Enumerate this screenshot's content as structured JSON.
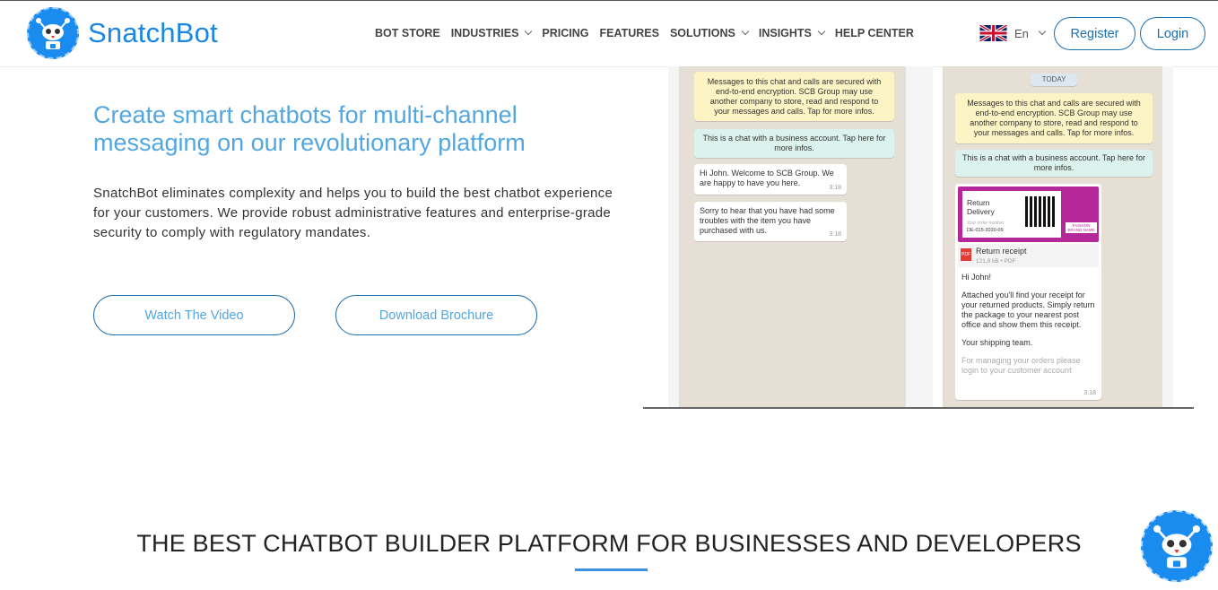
{
  "brand": {
    "name": "SnatchBot",
    "accent": "#1a86e6"
  },
  "nav": {
    "items": [
      {
        "label": "BOT STORE",
        "dropdown": false
      },
      {
        "label": "INDUSTRIES",
        "dropdown": true
      },
      {
        "label": "PRICING",
        "dropdown": false
      },
      {
        "label": "FEATURES",
        "dropdown": false
      },
      {
        "label": "SOLUTIONS",
        "dropdown": true
      },
      {
        "label": "INSIGHTS",
        "dropdown": true
      },
      {
        "label": "HELP CENTER",
        "dropdown": false
      }
    ],
    "language": "En",
    "register_label": "Register",
    "login_label": "Login"
  },
  "hero": {
    "title": "Create smart chatbots for multi-channel messaging on our revolutionary platform",
    "description": "SnatchBot eliminates complexity and helps you to build the best chatbot experience for your customers. We provide robust administrative features and enterprise-grade security to comply with regulatory mandates.",
    "watch_video_label": "Watch The Video",
    "download_brochure_label": "Download Brochure"
  },
  "chat_left": {
    "encryption_notice": "Messages to this chat and calls are secured with end-to-end encryption. SCB Group may use another company to store, read and respond to your messages and calls. Tap for more infos.",
    "business_notice": "This is a chat with a business account. Tap here for more infos.",
    "msg1": "Hi John. Welcome to SCB Group. We are happy to have you here.",
    "msg1_time": "3:18",
    "msg2": "Sorry to hear that you have had some troubles with the item you have purchased with us.",
    "msg2_time": "3:18"
  },
  "chat_right": {
    "date_chip": "TODAY",
    "encryption_notice": "Messages to this chat and calls are secured with end-to-end encryption. SCB Group may use another company to store, read and respond to your messages and calls. Tap for more infos.",
    "business_notice": "This is a chat with a business account. Tap here for more infos.",
    "card_title": "Return Delivery",
    "card_order_label": "Your order number",
    "card_order_number": "DE-015-2020-09",
    "card_brand": "FASHION BRAND NAME",
    "file_badge": "PDF",
    "file_name": "Return receipt",
    "file_meta": "121,9 kB • PDF",
    "greeting": "Hi John!",
    "body": "Attached you'll find your receipt for your returned products. Simply return the package to your nearest post office and show them this receipt.",
    "signoff": "Your shipping team.",
    "footer": "For managing your orders please login to your customer account",
    "time": "3:18"
  },
  "section": {
    "title": "THE BEST CHATBOT BUILDER PLATFORM FOR BUSINESSES AND DEVELOPERS"
  }
}
